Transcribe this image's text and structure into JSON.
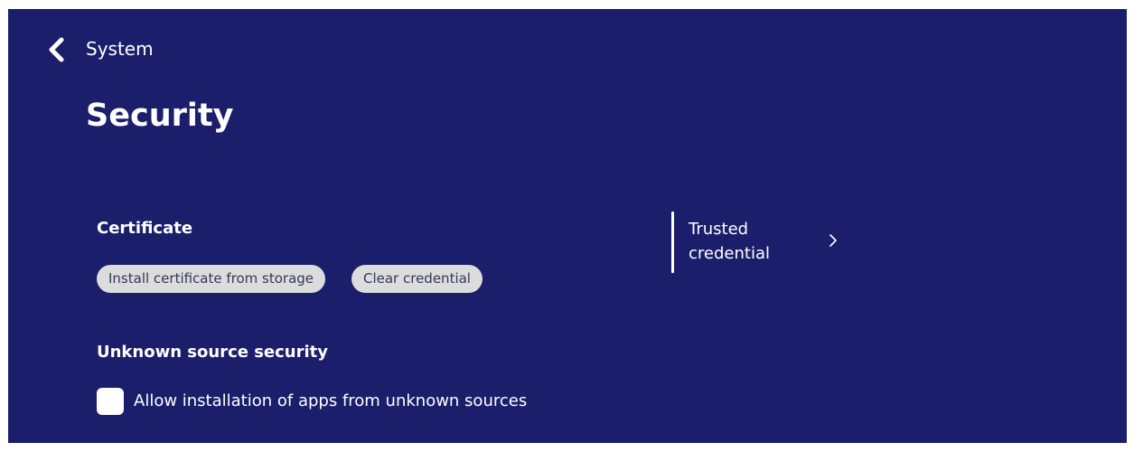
{
  "header": {
    "breadcrumb": "System",
    "title": "Security",
    "back_icon": "chevron-left-icon"
  },
  "certificate": {
    "heading": "Certificate",
    "install_label": "Install certificate from storage",
    "clear_label": "Clear credential",
    "trusted_label": "Trusted credential",
    "trusted_icon": "chevron-right-icon"
  },
  "unknown_source": {
    "heading": "Unknown source security",
    "checkbox_label": "Allow installation of apps from unknown sources",
    "checked": false
  },
  "colors": {
    "background": "#1b1f6b",
    "text": "#ffffff",
    "pill_background": "#dcdcdc",
    "pill_text": "#333a55"
  }
}
